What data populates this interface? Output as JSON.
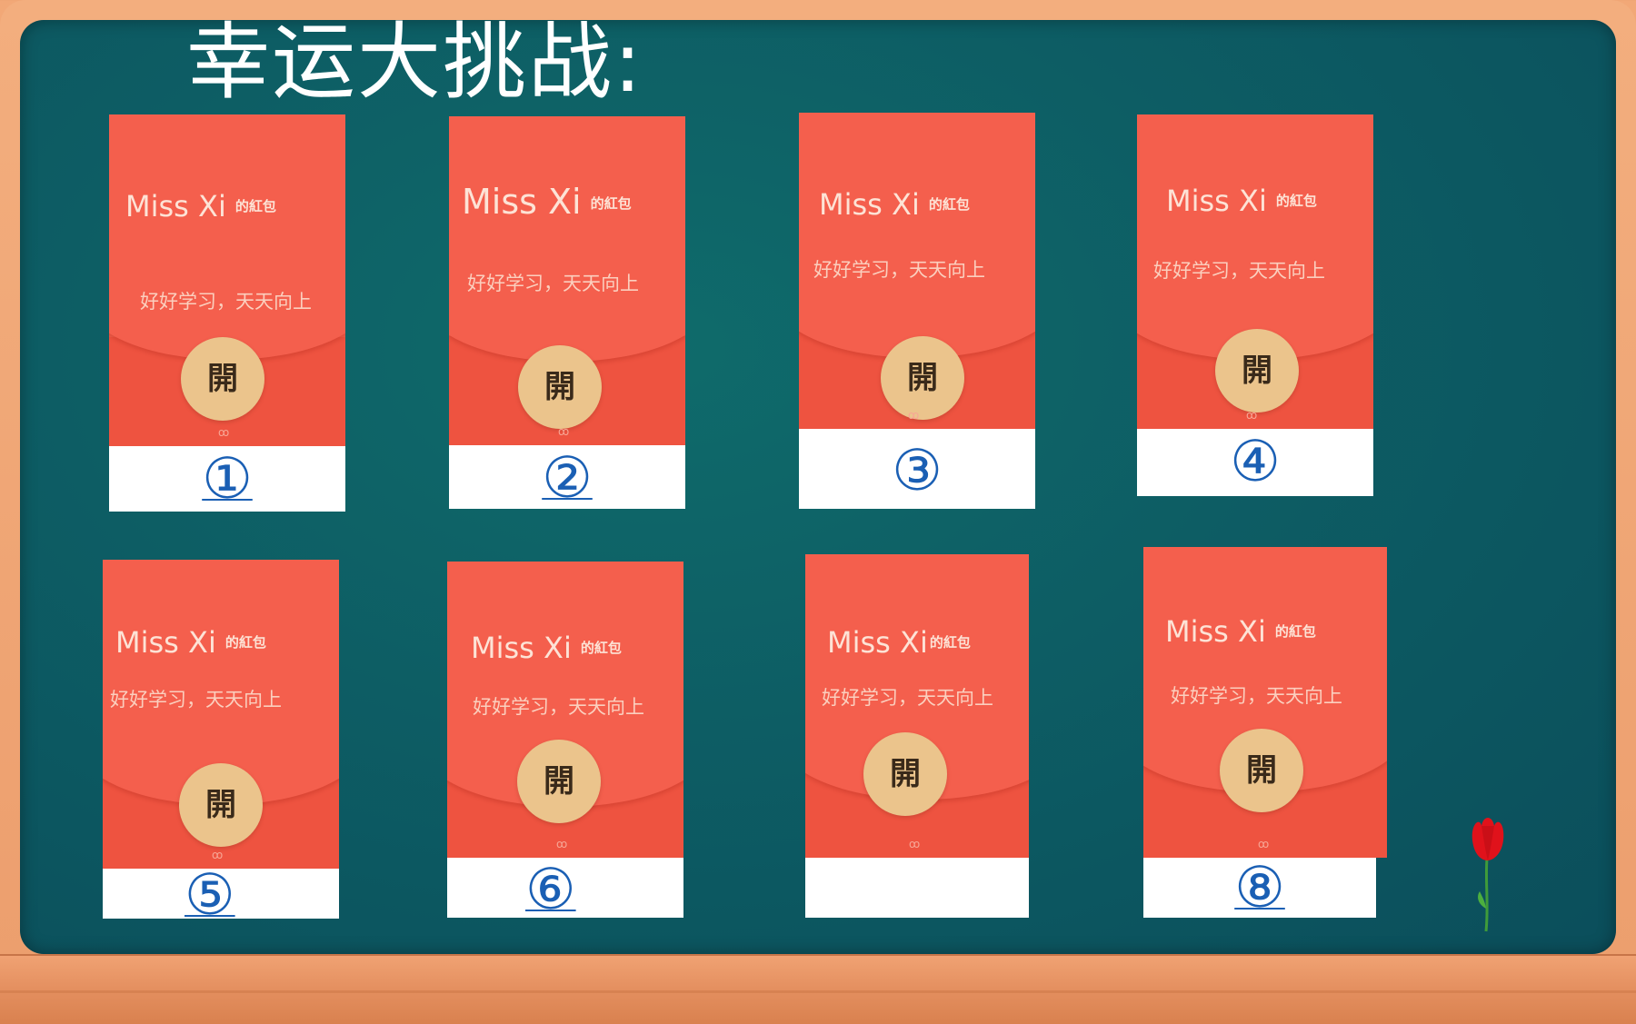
{
  "title": "幸运大挑战:",
  "envelopes": [
    {
      "number": "①",
      "sender": "Miss Xi",
      "suffix": "的紅包",
      "blessing": "好好学习，天天向上",
      "open_label": "開"
    },
    {
      "number": "②",
      "sender": "Miss Xi",
      "suffix": "的紅包",
      "blessing": "好好学习，天天向上",
      "open_label": "開"
    },
    {
      "number": "③",
      "sender": "Miss Xi",
      "suffix": "的紅包",
      "blessing": "好好学习，天天向上",
      "open_label": "開"
    },
    {
      "number": "④",
      "sender": "Miss Xi",
      "suffix": "的紅包",
      "blessing": "好好学习，天天向上",
      "open_label": "開"
    },
    {
      "number": "⑤",
      "sender": "Miss Xi",
      "suffix": "的紅包",
      "blessing": "好好学习，天天向上",
      "open_label": "開"
    },
    {
      "number": "⑥",
      "sender": "Miss Xi",
      "suffix": "的紅包",
      "blessing": "好好学习，天天向上",
      "open_label": "開"
    },
    {
      "number": "",
      "sender": "Miss Xi",
      "suffix": "的紅包",
      "blessing": "好好学习，天天向上",
      "open_label": "開"
    },
    {
      "number": "⑧",
      "sender": "Miss Xi",
      "suffix": "的紅包",
      "blessing": "好好学习，天天向上",
      "open_label": "開"
    }
  ],
  "colors": {
    "board": "#0d5d64",
    "frame": "#ec9e6d",
    "envelope": "#f25f4b",
    "open_button": "#ebc48c",
    "number": "#1a5fb4"
  },
  "decoration": {
    "icon": "tulip-icon"
  }
}
